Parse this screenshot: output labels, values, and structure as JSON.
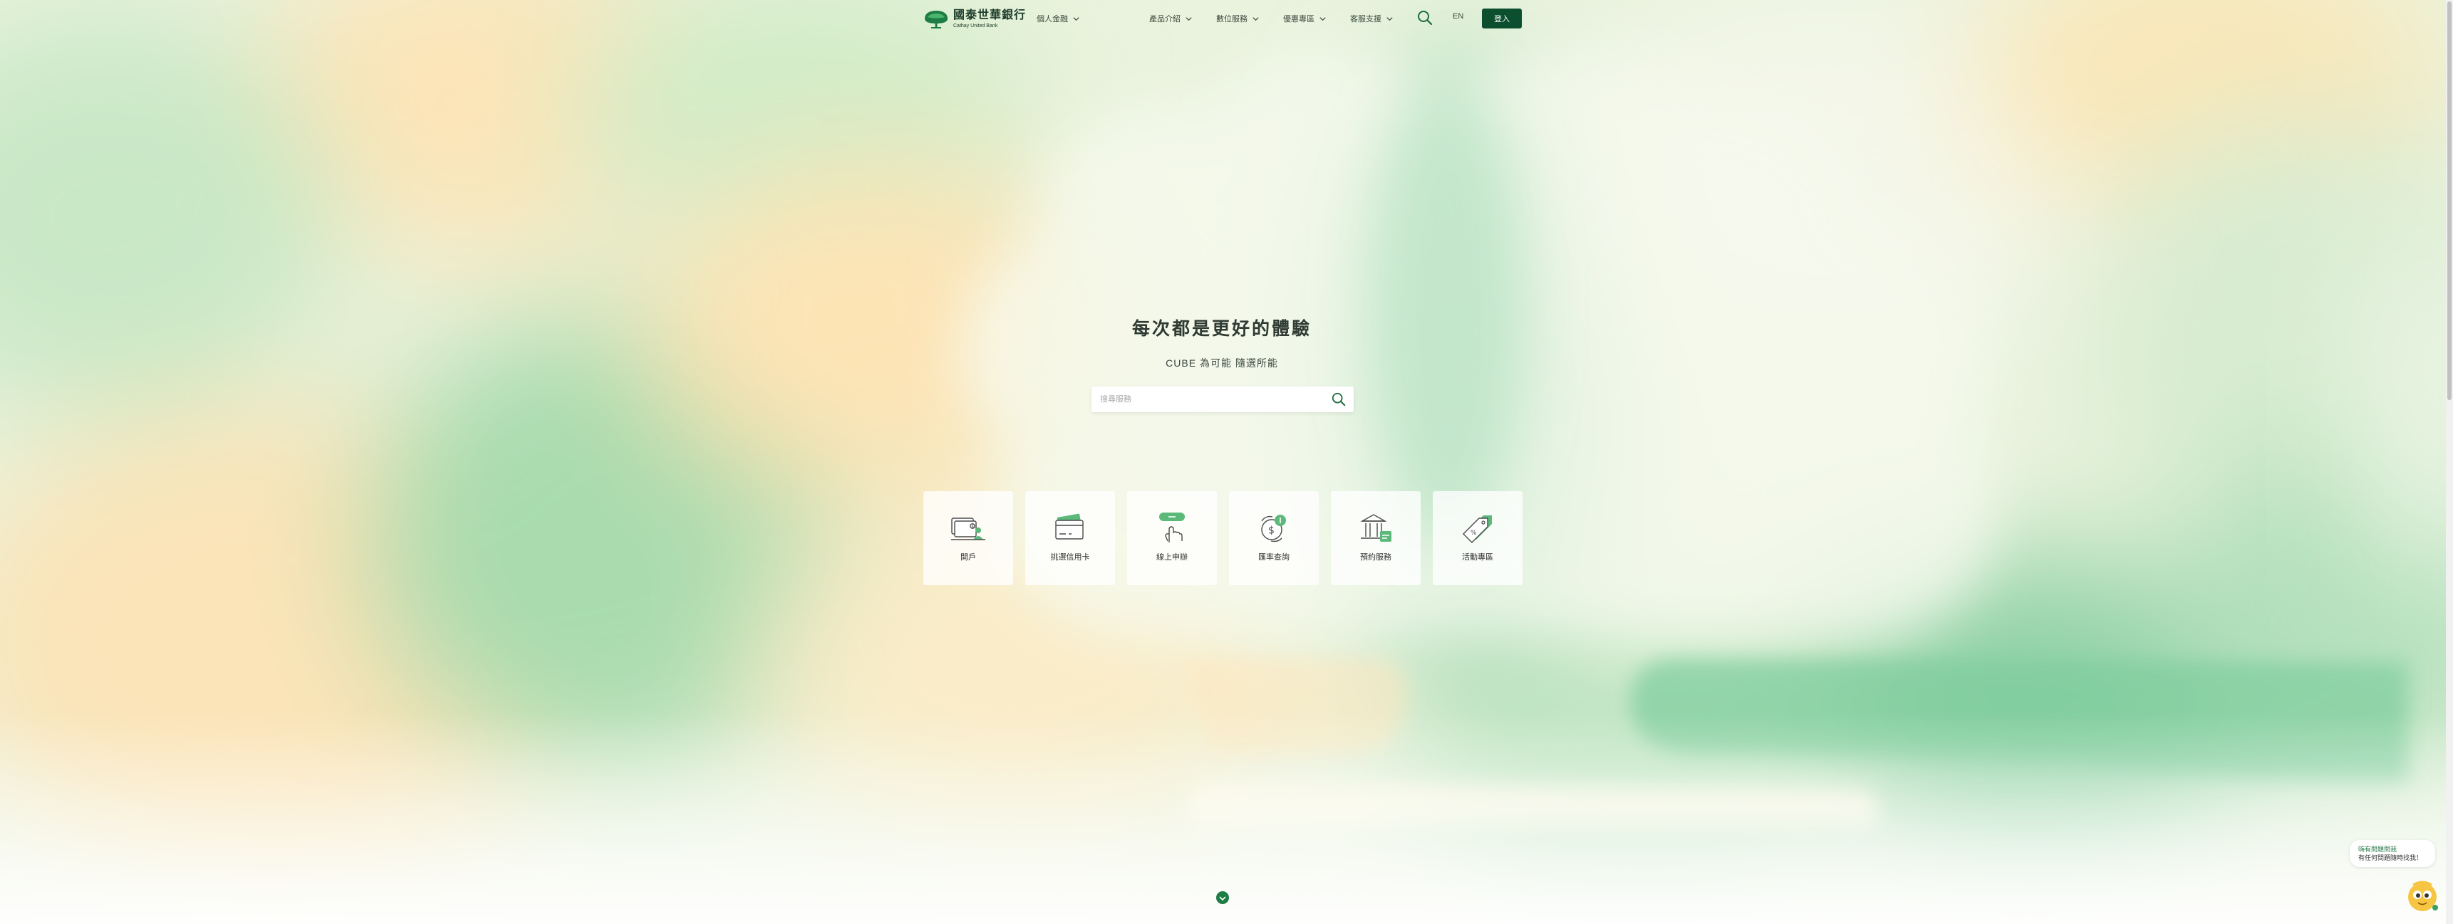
{
  "header": {
    "brand": {
      "name": "國泰世華銀行",
      "name_en": "Cathay United Bank"
    },
    "personal_menu": "個人金融",
    "nav": [
      {
        "label": "產品介紹"
      },
      {
        "label": "數位服務"
      },
      {
        "label": "優惠專區"
      },
      {
        "label": "客服支援"
      }
    ],
    "lang": "EN",
    "login": "登入",
    "search_icon": "search-icon",
    "chevron_icon": "chevron-down-icon"
  },
  "hero": {
    "title": "每次都是更好的體驗",
    "subtitle": "CUBE 為可能 隨選所能",
    "search_placeholder": "搜尋服務"
  },
  "quick_links": [
    {
      "label": "開戶",
      "icon": "open-account-icon"
    },
    {
      "label": "挑選信用卡",
      "icon": "credit-card-icon"
    },
    {
      "label": "線上申辦",
      "icon": "online-apply-icon"
    },
    {
      "label": "匯率查詢",
      "icon": "exchange-rate-icon"
    },
    {
      "label": "預約服務",
      "icon": "bank-appointment-icon"
    },
    {
      "label": "活動專區",
      "icon": "promotion-tag-icon"
    }
  ],
  "chatbot": {
    "line1": "嗨有問題問我",
    "line2": "有任何問題隨時找我！",
    "icon": "chatbot-avatar-icon"
  },
  "colors": {
    "primary": "#0b4f2f",
    "accent": "#34a060",
    "text": "#2f3a33"
  }
}
